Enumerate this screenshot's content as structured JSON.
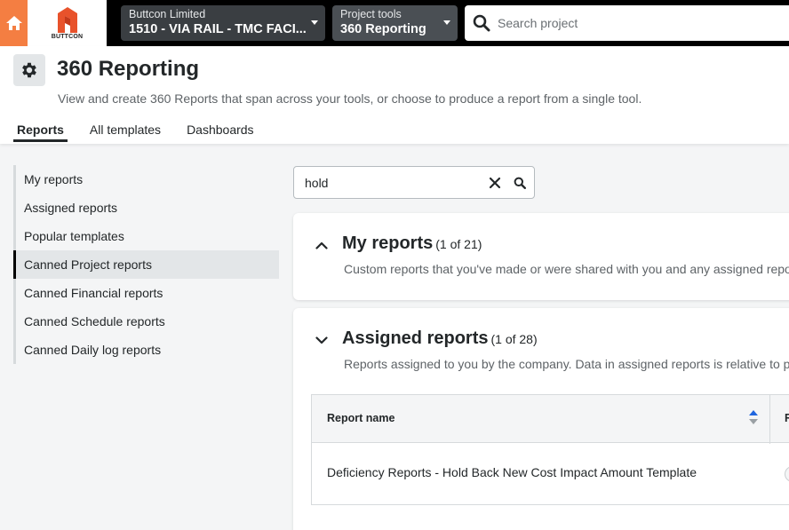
{
  "topbar": {
    "logo_text": "BUTTCON",
    "company_label": "Buttcon Limited",
    "project_value": "1510 - VIA RAIL - TMC FACI...",
    "tools_label": "Project tools",
    "tools_value": "360 Reporting",
    "search_placeholder": "Search project"
  },
  "header": {
    "title": "360 Reporting",
    "subtitle": "View and create 360 Reports that span across your tools, or choose to produce a report from a single tool.",
    "tabs": [
      {
        "label": "Reports"
      },
      {
        "label": "All templates"
      },
      {
        "label": "Dashboards"
      }
    ]
  },
  "sidebar": {
    "items": [
      {
        "label": "My reports"
      },
      {
        "label": "Assigned reports"
      },
      {
        "label": "Popular templates"
      },
      {
        "label": "Canned Project reports"
      },
      {
        "label": "Canned Financial reports"
      },
      {
        "label": "Canned Schedule reports"
      },
      {
        "label": "Canned Daily log reports"
      }
    ],
    "active_index": 3
  },
  "filter": {
    "value": "hold"
  },
  "sections": [
    {
      "title": "My reports",
      "count": "(1 of 21)",
      "description": "Custom reports that you've made or were shared with you and any assigned reports.",
      "expanded": false
    },
    {
      "title": "Assigned reports",
      "count": "(1 of 28)",
      "description": "Reports assigned to you by the company. Data in assigned reports is relative to permissions.",
      "expanded": true,
      "table": {
        "columns": [
          "Report name",
          "R"
        ],
        "rows": [
          {
            "name": "Deficiency Reports - Hold Back New Cost Impact Amount Template"
          }
        ]
      }
    }
  ],
  "colors": {
    "brand_orange": "#f47e42",
    "topbar": "#000000",
    "sort_active": "#2066df"
  }
}
